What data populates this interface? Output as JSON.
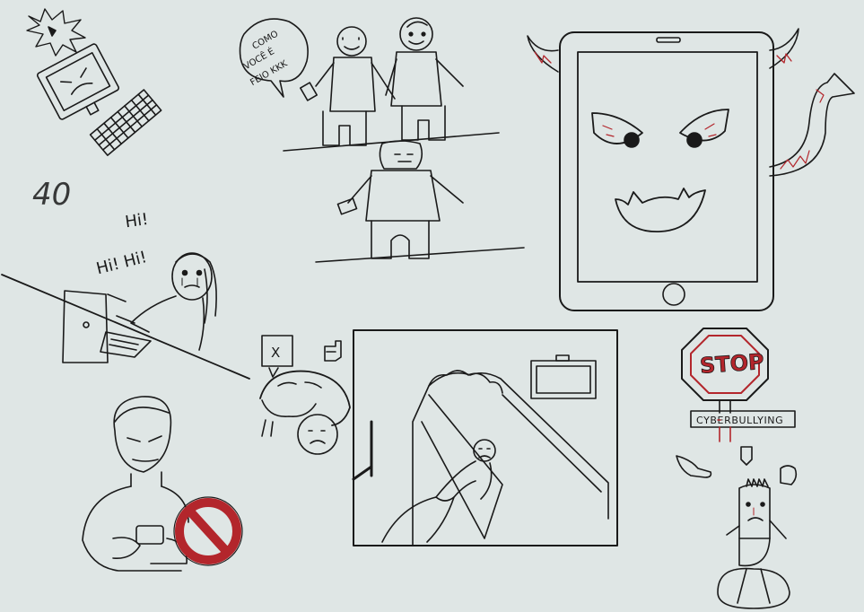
{
  "drawing": {
    "ink_color": "#1a1a1a",
    "accent_color": "#b3262c",
    "paper_color": "#dfe6e5",
    "number_mark": "40",
    "laughter_line1": "Hi!",
    "laughter_line2": "Hi! Hi!",
    "speech_bubble_lines": [
      "COMO",
      "VOCÊ É",
      "FEIO KKK"
    ],
    "x_bubble": "X",
    "stop_sign": "STOP",
    "banner": "CYBERBULLYING"
  }
}
